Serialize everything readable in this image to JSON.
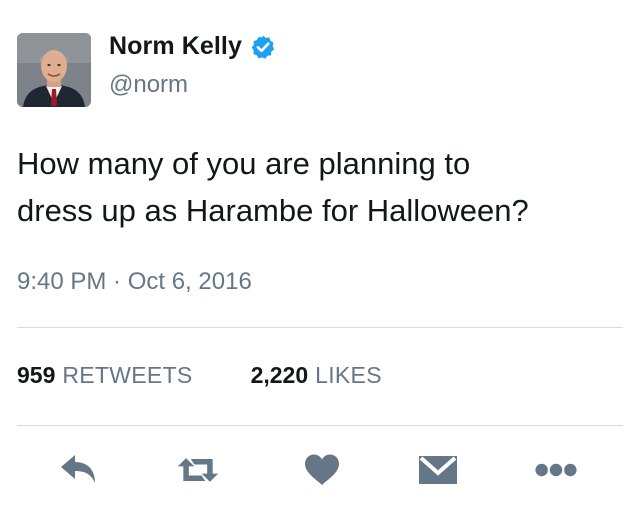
{
  "author": {
    "name": "Norm Kelly",
    "handle": "@norm",
    "verified": true
  },
  "tweet": {
    "text_lines": [
      "How many of you are planning to",
      "dress up as Harambe for Halloween?"
    ],
    "timestamp": "9:40 PM · Oct 6, 2016"
  },
  "stats": {
    "retweets_count": "959",
    "retweets_label": "RETWEETS",
    "likes_count": "2,220",
    "likes_label": "LIKES"
  },
  "actions": [
    {
      "name": "reply",
      "icon": "reply-icon"
    },
    {
      "name": "retweet",
      "icon": "retweet-icon"
    },
    {
      "name": "like",
      "icon": "heart-icon"
    },
    {
      "name": "direct-message",
      "icon": "envelope-icon"
    },
    {
      "name": "more",
      "icon": "more-icon"
    }
  ],
  "colors": {
    "text": "#14171a",
    "secondary": "#657786",
    "icon": "#657786",
    "verified_blue": "#1da1f2",
    "divider": "#d5dbe0"
  }
}
